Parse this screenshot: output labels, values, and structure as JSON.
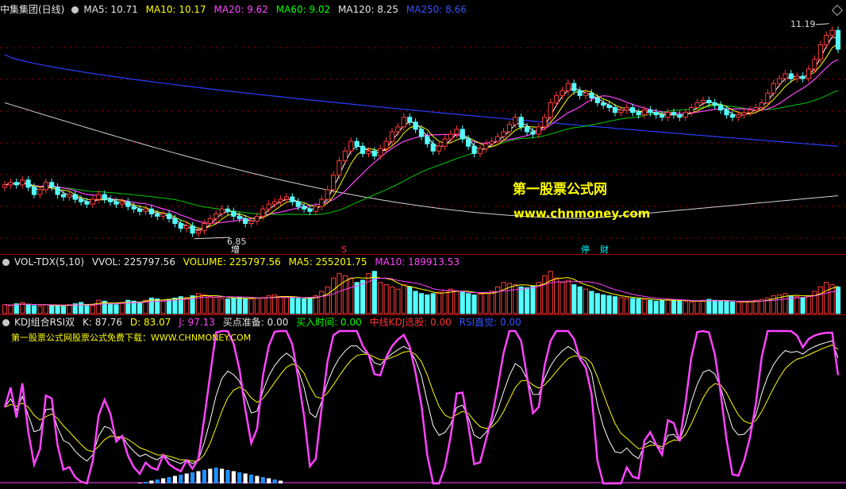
{
  "price_header": {
    "stock": "中集集团(日线)",
    "ma5": "MA5: 10.71",
    "ma10": "MA10: 10.17",
    "ma20": "MA20: 9.62",
    "ma60": "MA60: 9.02",
    "ma120": "MA120: 8.25",
    "ma250": "MA250: 8.66"
  },
  "price_labels": {
    "high": "11.19",
    "low": "6.85",
    "mark_zeng": "增",
    "mark_s": "S",
    "mark_ting": "停",
    "mark_cai": "财"
  },
  "watermark": {
    "line1": "第一股票公式网",
    "line2": "www.chnmoney.com"
  },
  "vol_header": {
    "name": "VOL-TDX(5,10)",
    "vvol": "VVOL: 225797.56",
    "volume": "VOLUME: 225797.56",
    "ma5": "MA5: 255201.75",
    "ma10": "MA10: 189913.53"
  },
  "kdj_header": {
    "name": "KDJ组合RSI双",
    "k": "K: 87.76",
    "d": "D: 83.07",
    "j": "J: 97.13",
    "buy_prep": "买点准备: 0.00",
    "buy_time": "买入时间: 0.00",
    "mid_kdj": "中线KDJ选股: 0.00",
    "rsi": "RSI直觉: 0.00"
  },
  "kdj_note": "第一股票公式网股票公式免费下载：WWW.CHNMONEY.COM",
  "colors": {
    "up": "#ff3b3b",
    "down": "#54ffff",
    "ma5": "#ffffff",
    "ma10": "#ffff00",
    "ma20": "#ff44ff",
    "ma60": "#00cc00",
    "ma120": "#d0d0d0",
    "ma250": "#2a3dff",
    "grid": "#aa0000"
  },
  "chart_data": {
    "type": "candlestick",
    "ylim": [
      6.5,
      11.4
    ],
    "close": [
      7.9,
      7.95,
      7.9,
      8.0,
      7.85,
      7.7,
      7.8,
      7.95,
      7.85,
      7.7,
      7.65,
      7.7,
      7.6,
      7.55,
      7.5,
      7.6,
      7.7,
      7.6,
      7.55,
      7.5,
      7.55,
      7.45,
      7.4,
      7.35,
      7.4,
      7.3,
      7.25,
      7.3,
      7.2,
      7.1,
      7.0,
      7.05,
      6.9,
      6.95,
      7.1,
      7.2,
      7.3,
      7.4,
      7.35,
      7.25,
      7.2,
      7.1,
      7.15,
      7.25,
      7.4,
      7.5,
      7.55,
      7.6,
      7.65,
      7.55,
      7.45,
      7.4,
      7.35,
      7.45,
      7.6,
      7.8,
      8.1,
      8.4,
      8.6,
      8.8,
      8.7,
      8.55,
      8.6,
      8.5,
      8.65,
      8.8,
      9.0,
      9.1,
      9.3,
      9.2,
      9.05,
      8.9,
      8.75,
      8.6,
      8.7,
      8.85,
      8.95,
      9.05,
      8.85,
      8.7,
      8.55,
      8.65,
      8.75,
      8.8,
      8.9,
      9.0,
      9.15,
      9.3,
      9.1,
      9.0,
      8.95,
      9.1,
      9.3,
      9.6,
      9.75,
      9.85,
      10.0,
      9.85,
      9.75,
      9.8,
      9.7,
      9.6,
      9.55,
      9.5,
      9.4,
      9.45,
      9.5,
      9.4,
      9.35,
      9.45,
      9.4,
      9.35,
      9.3,
      9.4,
      9.35,
      9.3,
      9.4,
      9.5,
      9.6,
      9.65,
      9.6,
      9.55,
      9.45,
      9.35,
      9.3,
      9.35,
      9.4,
      9.45,
      9.5,
      9.6,
      9.8,
      10.0,
      10.1,
      10.2,
      10.1,
      10.15,
      10.1,
      10.3,
      10.5,
      10.8,
      11.0,
      11.1,
      10.71
    ],
    "volume": [
      0.2,
      0.18,
      0.22,
      0.25,
      0.2,
      0.18,
      0.17,
      0.2,
      0.19,
      0.18,
      0.16,
      0.2,
      0.22,
      0.25,
      0.2,
      0.18,
      0.3,
      0.28,
      0.22,
      0.2,
      0.25,
      0.3,
      0.28,
      0.26,
      0.3,
      0.35,
      0.33,
      0.3,
      0.32,
      0.35,
      0.38,
      0.36,
      0.4,
      0.45,
      0.42,
      0.38,
      0.36,
      0.34,
      0.33,
      0.35,
      0.36,
      0.34,
      0.33,
      0.35,
      0.36,
      0.4,
      0.42,
      0.38,
      0.36,
      0.35,
      0.34,
      0.33,
      0.36,
      0.4,
      0.5,
      0.6,
      0.8,
      0.9,
      0.85,
      0.8,
      0.7,
      0.75,
      0.9,
      0.95,
      0.7,
      0.65,
      0.6,
      0.55,
      0.65,
      0.6,
      0.5,
      0.45,
      0.42,
      0.45,
      0.48,
      0.52,
      0.55,
      0.5,
      0.48,
      0.45,
      0.42,
      0.44,
      0.46,
      0.5,
      0.6,
      0.7,
      0.68,
      0.65,
      0.6,
      0.58,
      0.62,
      0.7,
      0.85,
      0.95,
      0.8,
      0.7,
      0.75,
      0.65,
      0.6,
      0.55,
      0.5,
      0.45,
      0.42,
      0.4,
      0.38,
      0.36,
      0.35,
      0.34,
      0.33,
      0.32,
      0.3,
      0.28,
      0.3,
      0.32,
      0.3,
      0.28,
      0.27,
      0.26,
      0.28,
      0.3,
      0.32,
      0.3,
      0.28,
      0.27,
      0.26,
      0.25,
      0.26,
      0.28,
      0.3,
      0.32,
      0.35,
      0.4,
      0.42,
      0.45,
      0.4,
      0.38,
      0.36,
      0.4,
      0.5,
      0.6,
      0.7,
      0.65,
      0.6
    ]
  }
}
